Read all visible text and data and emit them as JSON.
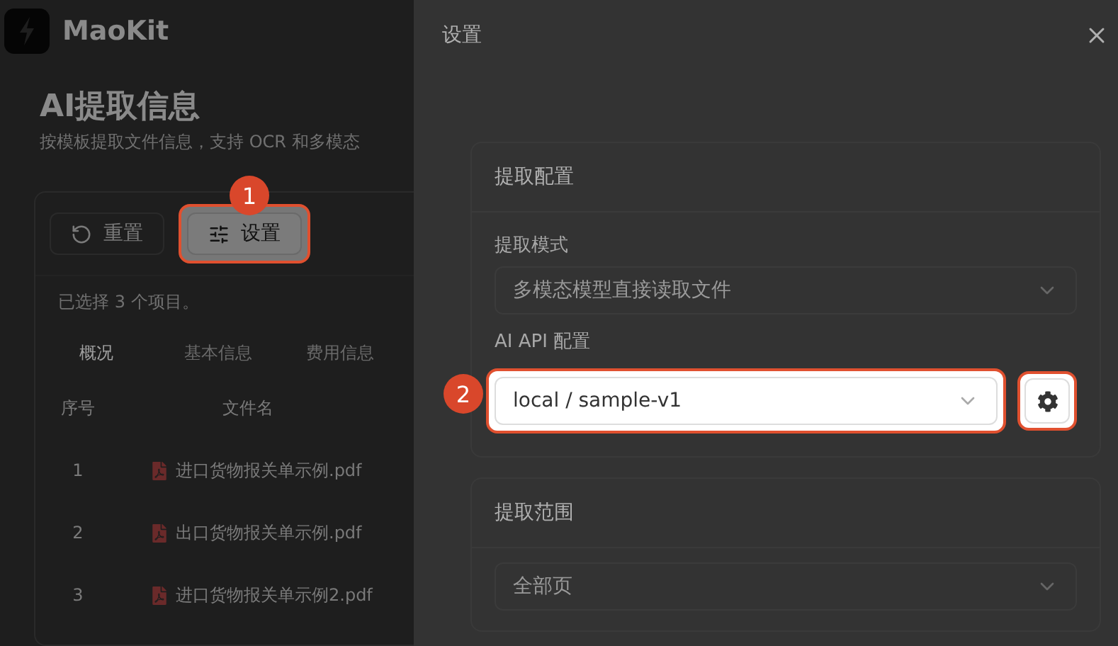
{
  "app": {
    "brand": "MaoKit"
  },
  "page": {
    "title": "AI提取信息",
    "subtitle": "按模板提取文件信息，支持 OCR 和多模态",
    "toolbar": [
      {
        "kind": "reset",
        "label": "重置",
        "highlighted": false
      },
      {
        "kind": "settings",
        "label": "设置",
        "highlighted": true,
        "callout": "1"
      }
    ],
    "selection_text": "已选择 3 个项目。",
    "tabs": [
      {
        "label": "概况",
        "selected": true
      },
      {
        "label": "基本信息",
        "selected": false
      },
      {
        "label": "费用信息",
        "selected": false
      }
    ],
    "table": {
      "columns": [
        "序号",
        "文件名"
      ],
      "rows": [
        {
          "index": "1",
          "file": "进口货物报关单示例.pdf"
        },
        {
          "index": "2",
          "file": "出口货物报关单示例.pdf"
        },
        {
          "index": "3",
          "file": "进口货物报关单示例2.pdf"
        }
      ]
    }
  },
  "drawer": {
    "title": "设置",
    "sections": [
      {
        "title": "提取配置",
        "fields": [
          {
            "label": "提取模式",
            "value": "多模态模型直接读取文件",
            "highlighted": false,
            "has_settings_button": false
          },
          {
            "label": "AI API 配置",
            "value": "local / sample-v1",
            "highlighted": true,
            "callout": "2",
            "has_settings_button": true
          }
        ]
      },
      {
        "title": "提取范围",
        "fields": [
          {
            "value": "全部页",
            "highlighted": false,
            "has_settings_button": false
          }
        ]
      }
    ]
  }
}
